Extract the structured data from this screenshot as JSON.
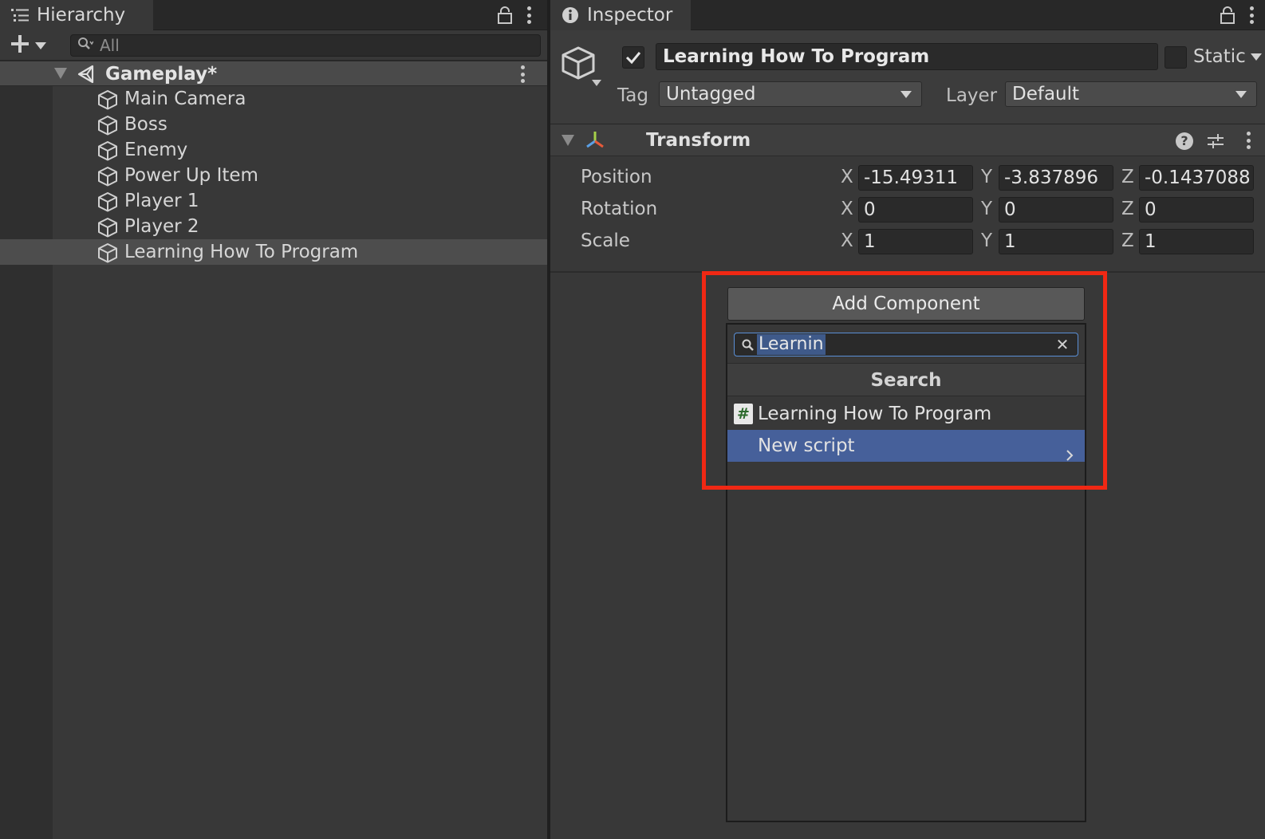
{
  "hierarchy": {
    "tab_label": "Hierarchy",
    "search_placeholder": "All",
    "scene": {
      "name": "Gameplay*"
    },
    "objects": [
      {
        "name": "Main Camera"
      },
      {
        "name": "Boss"
      },
      {
        "name": "Enemy"
      },
      {
        "name": "Power Up Item"
      },
      {
        "name": "Player 1"
      },
      {
        "name": "Player 2"
      },
      {
        "name": "Learning How To Program",
        "selected": true
      }
    ]
  },
  "inspector": {
    "tab_label": "Inspector",
    "object_name": "Learning How To Program",
    "active": true,
    "static_label": "Static",
    "tag_label": "Tag",
    "tag_value": "Untagged",
    "layer_label": "Layer",
    "layer_value": "Default",
    "transform": {
      "title": "Transform",
      "help_glyph": "?",
      "rows": [
        {
          "label": "Position",
          "x": "-15.49311",
          "y": "-3.837896",
          "z": "-0.1437088"
        },
        {
          "label": "Rotation",
          "x": "0",
          "y": "0",
          "z": "0"
        },
        {
          "label": "Scale",
          "x": "1",
          "y": "1",
          "z": "1"
        }
      ],
      "axis_x": "X",
      "axis_y": "Y",
      "axis_z": "Z"
    },
    "add_component": {
      "button_label": "Add Component",
      "search_query": "Learnin",
      "clear_glyph": "✕",
      "section_title": "Search",
      "results": [
        {
          "label": "Learning How To Program",
          "icon": "script-icon",
          "icon_glyph": "#"
        },
        {
          "label": "New script",
          "selected": true
        }
      ]
    }
  },
  "colors": {
    "highlight_box": "#f02814",
    "selection": "#46609a",
    "panel_bg": "#383838"
  }
}
